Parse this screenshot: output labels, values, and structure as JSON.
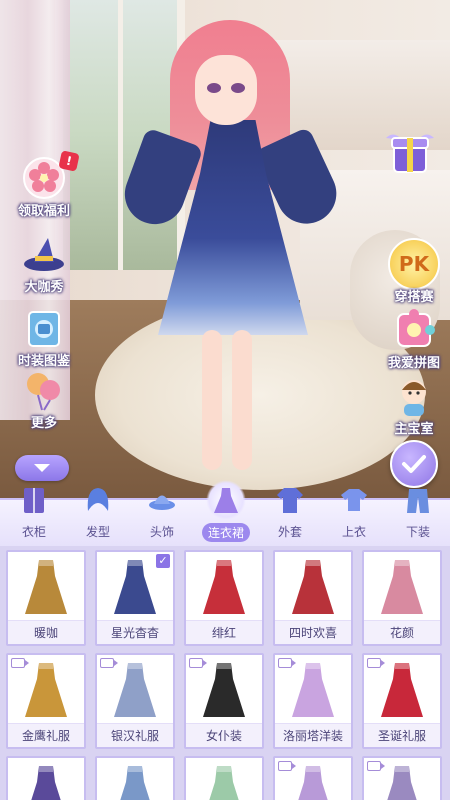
{
  "colors": {
    "accent": "#9c88ee",
    "tab_bg": "#e6e1fb",
    "grid_bg": "#d9d3f2",
    "text": "#4b4478"
  },
  "left_menu": [
    {
      "label": "领取福利",
      "icon": "sakura-gift-icon",
      "badge": "!"
    },
    {
      "label": "大咖秀",
      "icon": "witch-hat-icon"
    },
    {
      "label": "时装图鉴",
      "icon": "clothing-book-icon"
    },
    {
      "label": "更多",
      "icon": "balloon-icon"
    }
  ],
  "right_menu": [
    {
      "label": "",
      "icon": "gift-box-icon"
    },
    {
      "label": "穿搭赛",
      "icon": "pk-icon",
      "icon_text": "PK"
    },
    {
      "label": "我爱拼图",
      "icon": "puzzle-icon"
    },
    {
      "label": "主宝室",
      "icon": "baby-icon"
    }
  ],
  "tabs": [
    {
      "label": "衣柜",
      "icon": "wardrobe-icon",
      "active": false
    },
    {
      "label": "发型",
      "icon": "hair-icon",
      "active": false
    },
    {
      "label": "头饰",
      "icon": "headwear-icon",
      "active": false
    },
    {
      "label": "连衣裙",
      "icon": "dress-icon",
      "active": true
    },
    {
      "label": "外套",
      "icon": "coat-icon",
      "active": false
    },
    {
      "label": "上衣",
      "icon": "shirt-icon",
      "active": false
    },
    {
      "label": "下装",
      "icon": "pants-icon",
      "active": false
    }
  ],
  "items": [
    {
      "name": "暖咖",
      "color": "#b8893a",
      "video": false,
      "selected": false
    },
    {
      "name": "星光杳杳",
      "color": "#3b4a8f",
      "video": false,
      "selected": true
    },
    {
      "name": "绯红",
      "color": "#c62f3a",
      "video": false,
      "selected": false
    },
    {
      "name": "四时欢喜",
      "color": "#b8323a",
      "video": false,
      "selected": false
    },
    {
      "name": "花颜",
      "color": "#d88aa0",
      "video": false,
      "selected": false
    },
    {
      "name": "金鹰礼服",
      "color": "#c9963a",
      "video": true,
      "selected": false
    },
    {
      "name": "银汉礼服",
      "color": "#8fa0c8",
      "video": true,
      "selected": false
    },
    {
      "name": "女仆装",
      "color": "#2a2a2a",
      "video": true,
      "selected": false
    },
    {
      "name": "洛丽塔洋装",
      "color": "#c9a4e0",
      "video": true,
      "selected": false
    },
    {
      "name": "圣诞礼服",
      "color": "#c8283a",
      "video": true,
      "selected": false
    },
    {
      "name": "",
      "color": "#5a4a9a",
      "video": false,
      "selected": false
    },
    {
      "name": "",
      "color": "#7a98c8",
      "video": false,
      "selected": false
    },
    {
      "name": "",
      "color": "#9ccaa8",
      "video": false,
      "selected": false
    },
    {
      "name": "",
      "color": "#b89ad8",
      "video": true,
      "selected": false
    },
    {
      "name": "",
      "color": "#9a8ac0",
      "video": true,
      "selected": false
    }
  ]
}
